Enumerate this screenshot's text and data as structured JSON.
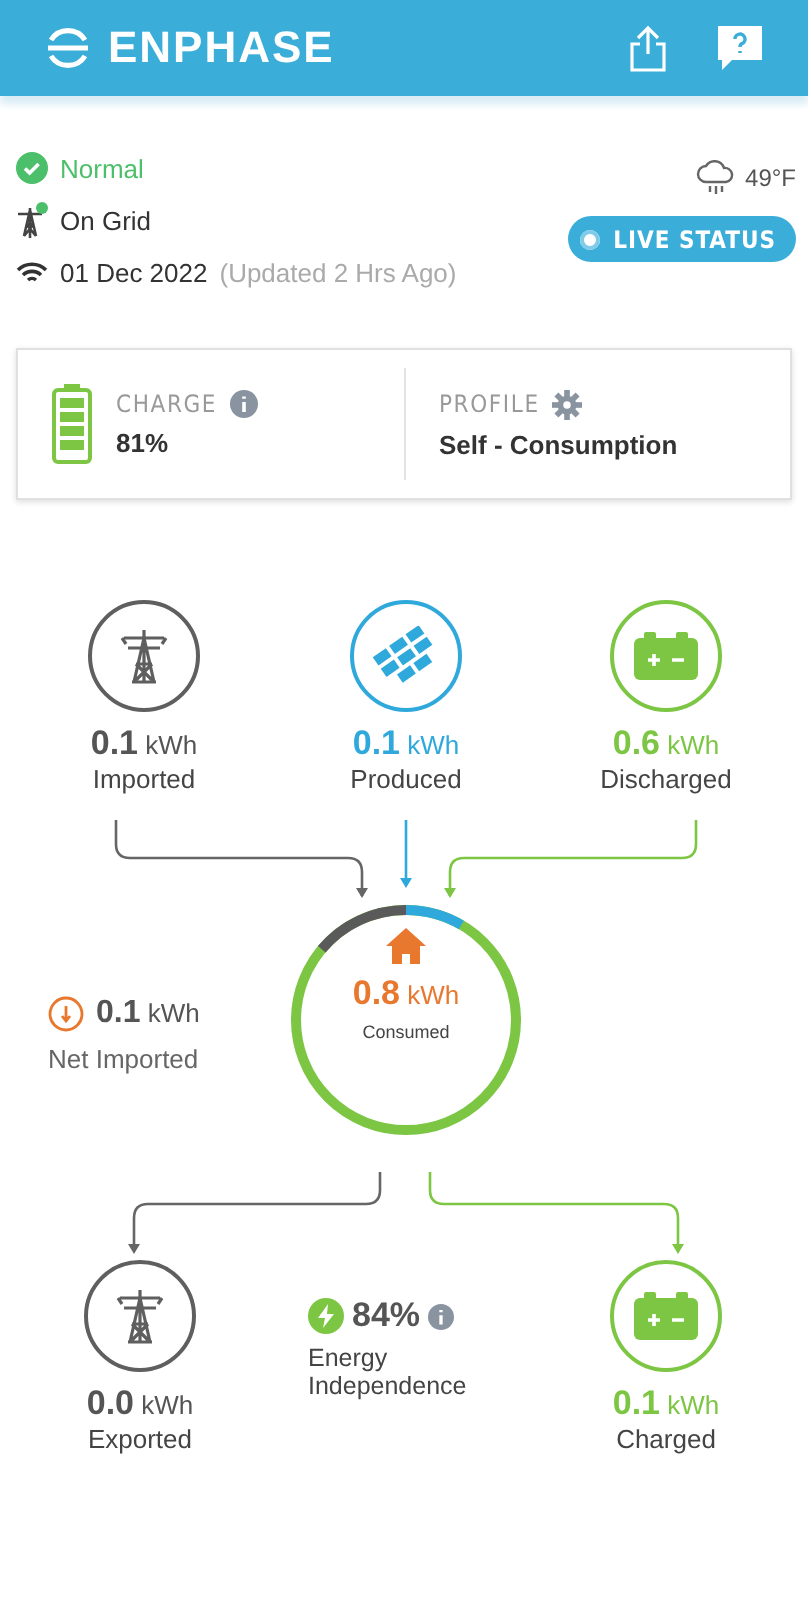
{
  "header": {
    "brand": "ENPHASE"
  },
  "status": {
    "items": [
      {
        "kind": "health",
        "text": "Normal"
      },
      {
        "kind": "grid",
        "text": "On Grid"
      },
      {
        "kind": "connection",
        "text": "01 Dec 2022",
        "note": "(Updated 2 Hrs Ago)"
      }
    ],
    "temperature": "49°F",
    "live_button": "LIVE STATUS"
  },
  "summary": {
    "charge": {
      "label": "CHARGE",
      "value": "81%"
    },
    "profile": {
      "label": "PROFILE",
      "value": "Self - Consumption"
    }
  },
  "flows": {
    "sources": [
      {
        "kind": "grid",
        "value": "0.1",
        "unit": "kWh",
        "label": "Imported"
      },
      {
        "kind": "solar",
        "value": "0.1",
        "unit": "kWh",
        "label": "Produced"
      },
      {
        "kind": "battery",
        "value": "0.6",
        "unit": "kWh",
        "label": "Discharged"
      }
    ],
    "consumed": {
      "value": "0.8",
      "unit": "kWh",
      "label": "Consumed"
    },
    "net": {
      "value": "0.1",
      "unit": "kWh",
      "label": "Net Imported"
    },
    "sinks": [
      {
        "kind": "grid",
        "value": "0.0",
        "unit": "kWh",
        "label": "Exported"
      },
      {
        "kind": "battery",
        "value": "0.1",
        "unit": "kWh",
        "label": "Charged"
      }
    ],
    "independence": {
      "value": "84%",
      "label": "Energy Independence"
    }
  }
}
